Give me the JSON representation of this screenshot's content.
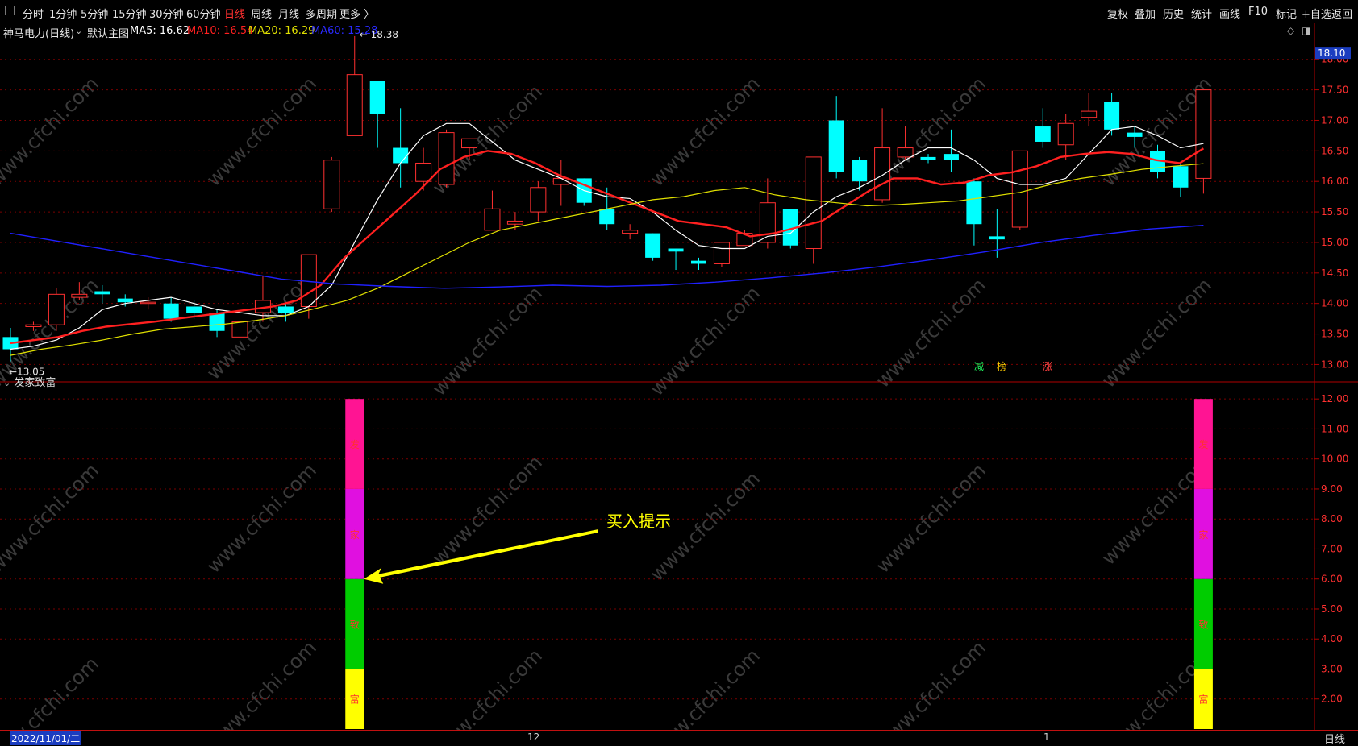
{
  "toolbar": {
    "periods": [
      "分时",
      "1分钟",
      "5分钟",
      "15分钟",
      "30分钟",
      "60分钟",
      "日线",
      "周线",
      "月线",
      "多周期",
      "更多 〉"
    ],
    "active_period": "日线",
    "right_buttons": [
      "复权",
      "叠加",
      "历史",
      "统计",
      "画线",
      "F10",
      "标记",
      "+自选",
      "返回"
    ]
  },
  "legend": {
    "stock_name": "神马电力(日线)",
    "main_chart_label": "默认主图",
    "ma5": "MA5: 16.62",
    "ma10": "MA10: 16.54",
    "ma20": "MA20: 16.29",
    "ma60": "MA60: 15.28"
  },
  "indicator": {
    "title": "发家致富",
    "annotation": "买入提示",
    "segment_chars": [
      "发",
      "家",
      "致",
      "富"
    ]
  },
  "dates": {
    "start": "2022/11/01/二",
    "month12": "12",
    "month1": "1",
    "period": "日线"
  },
  "colors": {
    "up": "#ff3030",
    "down": "#00ffff",
    "ma5": "#ffffff",
    "ma10": "#ff2020",
    "ma20": "#e0e000",
    "ma60": "#2020ff",
    "seg_fa": "#ff1493",
    "seg_jia": "#e010e0",
    "seg_zhi": "#00cc00",
    "seg_fu": "#ffff00"
  },
  "chart_data": [
    {
      "type": "candlestick",
      "title": "神马电力(日线)",
      "ylim": [
        12.9,
        18.3
      ],
      "y_ticks": [
        "13.00",
        "13.50",
        "14.00",
        "14.50",
        "15.00",
        "15.50",
        "16.00",
        "16.50",
        "17.00",
        "17.50",
        "18.00"
      ],
      "current_price_label": "18.10",
      "high_marker": "18.38",
      "low_marker": "13.05",
      "tags": [
        "减",
        "榜",
        "涨"
      ],
      "candles": [
        {
          "o": 13.45,
          "c": 13.25,
          "h": 13.6,
          "l": 13.05
        },
        {
          "o": 13.62,
          "c": 13.65,
          "h": 13.7,
          "l": 13.55
        },
        {
          "o": 13.65,
          "c": 14.15,
          "h": 14.25,
          "l": 13.55
        },
        {
          "o": 14.1,
          "c": 14.15,
          "h": 14.35,
          "l": 14.05
        },
        {
          "o": 14.2,
          "c": 14.15,
          "h": 14.3,
          "l": 14.0
        },
        {
          "o": 14.08,
          "c": 14.02,
          "h": 14.15,
          "l": 13.95
        },
        {
          "o": 14.0,
          "c": 14.02,
          "h": 14.1,
          "l": 13.9
        },
        {
          "o": 14.0,
          "c": 13.75,
          "h": 14.1,
          "l": 13.7
        },
        {
          "o": 13.95,
          "c": 13.85,
          "h": 14.05,
          "l": 13.75
        },
        {
          "o": 13.85,
          "c": 13.55,
          "h": 13.9,
          "l": 13.45
        },
        {
          "o": 13.45,
          "c": 13.7,
          "h": 13.9,
          "l": 13.4
        },
        {
          "o": 13.85,
          "c": 14.05,
          "h": 14.45,
          "l": 13.7
        },
        {
          "o": 13.95,
          "c": 13.85,
          "h": 14.0,
          "l": 13.7
        },
        {
          "o": 13.95,
          "c": 14.8,
          "h": 14.8,
          "l": 13.75
        },
        {
          "o": 15.55,
          "c": 16.35,
          "h": 16.4,
          "l": 15.5
        },
        {
          "o": 16.75,
          "c": 17.75,
          "h": 18.38,
          "l": 16.75
        },
        {
          "o": 17.65,
          "c": 17.1,
          "h": 17.65,
          "l": 16.55
        },
        {
          "o": 16.55,
          "c": 16.3,
          "h": 17.2,
          "l": 15.9
        },
        {
          "o": 16.0,
          "c": 16.3,
          "h": 16.55,
          "l": 15.85
        },
        {
          "o": 15.95,
          "c": 16.8,
          "h": 16.85,
          "l": 15.9
        },
        {
          "o": 16.55,
          "c": 16.7,
          "h": 16.7,
          "l": 16.35
        },
        {
          "o": 15.2,
          "c": 15.55,
          "h": 15.85,
          "l": 15.2
        },
        {
          "o": 15.3,
          "c": 15.35,
          "h": 15.5,
          "l": 15.2
        },
        {
          "o": 15.5,
          "c": 15.9,
          "h": 16.0,
          "l": 15.35
        },
        {
          "o": 15.95,
          "c": 16.05,
          "h": 16.35,
          "l": 15.6
        },
        {
          "o": 16.05,
          "c": 15.65,
          "h": 16.05,
          "l": 15.6
        },
        {
          "o": 15.55,
          "c": 15.3,
          "h": 15.9,
          "l": 15.2
        },
        {
          "o": 15.15,
          "c": 15.2,
          "h": 15.3,
          "l": 15.05
        },
        {
          "o": 15.15,
          "c": 14.75,
          "h": 15.15,
          "l": 14.7
        },
        {
          "o": 14.9,
          "c": 14.85,
          "h": 14.9,
          "l": 14.55
        },
        {
          "o": 14.7,
          "c": 14.65,
          "h": 14.75,
          "l": 14.55
        },
        {
          "o": 14.65,
          "c": 15.0,
          "h": 15.0,
          "l": 14.6
        },
        {
          "o": 14.95,
          "c": 15.15,
          "h": 15.2,
          "l": 14.95
        },
        {
          "o": 15.0,
          "c": 15.65,
          "h": 16.05,
          "l": 14.9
        },
        {
          "o": 15.55,
          "c": 14.95,
          "h": 15.55,
          "l": 14.9
        },
        {
          "o": 14.9,
          "c": 16.4,
          "h": 16.4,
          "l": 14.65
        },
        {
          "o": 17.0,
          "c": 16.15,
          "h": 17.4,
          "l": 16.05
        },
        {
          "o": 16.35,
          "c": 16.0,
          "h": 16.4,
          "l": 15.85
        },
        {
          "o": 15.7,
          "c": 16.55,
          "h": 17.2,
          "l": 15.65
        },
        {
          "o": 16.4,
          "c": 16.55,
          "h": 16.9,
          "l": 16.35
        },
        {
          "o": 16.4,
          "c": 16.35,
          "h": 16.45,
          "l": 16.3
        },
        {
          "o": 16.45,
          "c": 16.35,
          "h": 16.85,
          "l": 16.15
        },
        {
          "o": 16.0,
          "c": 15.3,
          "h": 16.05,
          "l": 14.95
        },
        {
          "o": 15.1,
          "c": 15.05,
          "h": 15.55,
          "l": 14.75
        },
        {
          "o": 15.25,
          "c": 16.5,
          "h": 16.5,
          "l": 15.2
        },
        {
          "o": 16.9,
          "c": 16.65,
          "h": 17.2,
          "l": 16.55
        },
        {
          "o": 16.6,
          "c": 16.95,
          "h": 17.1,
          "l": 16.35
        },
        {
          "o": 17.05,
          "c": 17.15,
          "h": 17.45,
          "l": 16.9
        },
        {
          "o": 17.3,
          "c": 16.85,
          "h": 17.45,
          "l": 16.75
        },
        {
          "o": 16.8,
          "c": 16.73,
          "h": 16.9,
          "l": 16.55
        },
        {
          "o": 16.5,
          "c": 16.15,
          "h": 16.6,
          "l": 16.05
        },
        {
          "o": 16.25,
          "c": 15.9,
          "h": 16.3,
          "l": 15.75
        },
        {
          "o": 16.05,
          "c": 17.5,
          "h": 17.5,
          "l": 15.8
        }
      ],
      "series": [
        {
          "name": "MA5",
          "values": [
            13.25,
            13.3,
            13.4,
            13.6,
            13.9,
            14.0,
            14.05,
            14.1,
            14.0,
            13.9,
            13.85,
            13.8,
            13.8,
            13.95,
            14.3,
            15.0,
            15.7,
            16.3,
            16.75,
            16.95,
            16.95,
            16.65,
            16.35,
            16.2,
            16.05,
            15.85,
            15.75,
            15.72,
            15.5,
            15.2,
            14.95,
            14.9,
            14.9,
            15.1,
            15.15,
            15.5,
            15.75,
            15.9,
            16.1,
            16.35,
            16.55,
            16.55,
            16.35,
            16.05,
            15.95,
            15.95,
            16.05,
            16.45,
            16.85,
            16.9,
            16.75,
            16.55,
            16.62
          ]
        },
        {
          "name": "MA10",
          "values": [
            13.35,
            13.4,
            13.45,
            13.55,
            13.62,
            13.66,
            13.7,
            13.75,
            13.8,
            13.85,
            13.9,
            13.95,
            14.05,
            14.3,
            14.75,
            15.1,
            15.45,
            15.8,
            16.2,
            16.4,
            16.5,
            16.45,
            16.3,
            16.1,
            15.95,
            15.8,
            15.65,
            15.5,
            15.35,
            15.3,
            15.25,
            15.1,
            15.15,
            15.25,
            15.35,
            15.6,
            15.85,
            16.05,
            16.05,
            15.95,
            15.98,
            16.1,
            16.15,
            16.25,
            16.4,
            16.45,
            16.48,
            16.45,
            16.35,
            16.3,
            16.54
          ]
        },
        {
          "name": "MA20",
          "values": [
            13.15,
            13.25,
            13.32,
            13.4,
            13.5,
            13.58,
            13.62,
            13.66,
            13.72,
            13.8,
            13.92,
            14.05,
            14.25,
            14.5,
            14.75,
            15.0,
            15.2,
            15.3,
            15.4,
            15.5,
            15.6,
            15.7,
            15.75,
            15.85,
            15.9,
            15.78,
            15.7,
            15.65,
            15.6,
            15.62,
            15.65,
            15.68,
            15.75,
            15.82,
            15.95,
            16.05,
            16.12,
            16.2,
            16.25,
            16.29
          ]
        },
        {
          "name": "MA60",
          "values": [
            15.15,
            15.0,
            14.85,
            14.7,
            14.55,
            14.4,
            14.32,
            14.28,
            14.25,
            14.27,
            14.3,
            14.28,
            14.3,
            14.35,
            14.42,
            14.5,
            14.6,
            14.72,
            14.85,
            15.0,
            15.12,
            15.22,
            15.28
          ]
        }
      ]
    },
    {
      "type": "bar",
      "title": "发家致富",
      "ylim": [
        1.0,
        12.3
      ],
      "y_ticks": [
        "2.00",
        "3.00",
        "4.00",
        "5.00",
        "6.00",
        "7.00",
        "8.00",
        "9.00",
        "10.00",
        "11.00",
        "12.00"
      ],
      "annotation": "买入提示",
      "signals": [
        {
          "index": 15,
          "segments": [
            {
              "label": "富",
              "from": 0,
              "to": 3
            },
            {
              "label": "致",
              "from": 3,
              "to": 6
            },
            {
              "label": "家",
              "from": 6,
              "to": 9
            },
            {
              "label": "发",
              "from": 9,
              "to": 12
            }
          ]
        },
        {
          "index": 52,
          "segments": [
            {
              "label": "富",
              "from": 0,
              "to": 3
            },
            {
              "label": "致",
              "from": 3,
              "to": 6
            },
            {
              "label": "家",
              "from": 6,
              "to": 9
            },
            {
              "label": "发",
              "from": 9,
              "to": 12
            }
          ]
        }
      ]
    }
  ]
}
